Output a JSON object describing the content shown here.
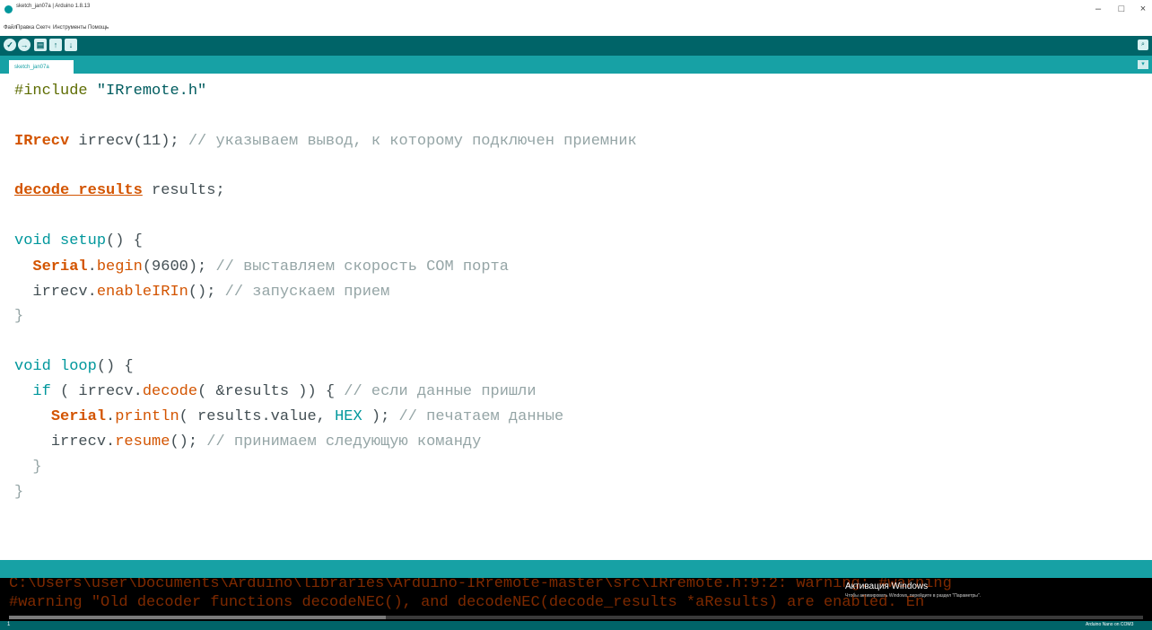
{
  "window": {
    "title": "sketch_jan07a | Arduino 1.8.13",
    "minimize": "–",
    "maximize": "□",
    "close": "×"
  },
  "menu": [
    "Файл",
    "Правка",
    "Скетч",
    "Инструменты",
    "Помощь"
  ],
  "toolbar": {
    "verify": "✓",
    "upload": "→",
    "new": "▤",
    "open": "↑",
    "save": "↓",
    "serial_monitor": "⌕"
  },
  "tab": {
    "name": "sketch_jan07a",
    "menu": "▾"
  },
  "code": {
    "l1": {
      "pre": "#include",
      "str": "\"IRremote.h\""
    },
    "l3": {
      "type": "IRrecv",
      "rest": " irrecv(11); ",
      "cmt": "// указываем вывод, к которому подключен приемник"
    },
    "l5": {
      "type": "decode_results",
      "rest": " results;"
    },
    "l7": {
      "kw": "void",
      "sp": " ",
      "fn": "setup",
      "rest": "() {"
    },
    "l8": {
      "ind": "  ",
      "obj": "Serial",
      "dot": ".",
      "fn": "begin",
      "rest": "(9600); ",
      "cmt": "// выставляем скорость COM порта"
    },
    "l9": {
      "ind": "  ",
      "pre": "irrecv.",
      "fn": "enableIRIn",
      "rest": "(); ",
      "cmt": "// запускаем прием"
    },
    "l10": {
      "text": "}"
    },
    "l12": {
      "kw": "void",
      "sp": " ",
      "fn": "loop",
      "rest": "() {"
    },
    "l13": {
      "ind": "  ",
      "kw": "if",
      "a": " ( irrecv.",
      "fn": "decode",
      "b": "( &results )) { ",
      "cmt": "// если данные пришли"
    },
    "l14": {
      "ind": "    ",
      "obj": "Serial",
      "dot": ".",
      "fn": "println",
      "a": "( results.value, ",
      "const": "HEX",
      "b": " ); ",
      "cmt": "// печатаем данные"
    },
    "l15": {
      "ind": "    ",
      "pre": "irrecv.",
      "fn": "resume",
      "rest": "(); ",
      "cmt": "// принимаем следующую команду"
    },
    "l16": {
      "text": "  }"
    },
    "l17": {
      "text": "}"
    }
  },
  "console": {
    "line1": "C:\\Users\\user\\Documents\\Arduino\\libraries\\Arduino-IRremote-master\\src\\IRremote.h:9:2: warning: #warning",
    "line2": "#warning \"Old decoder functions decodeNEC(), and decodeNEC(decode_results *aResults) are enabled. En",
    "activation_title": "Активация Windows",
    "activation_sub": "Чтобы активировать Windows, перейдите в раздел \"Параметры\"."
  },
  "status": {
    "line": "1",
    "board": "Arduino Nano on COM3"
  },
  "colors": {
    "toolbar": "#006468",
    "tabbar": "#17a1a5",
    "keyword_orange": "#d35400",
    "keyword_teal": "#00979c",
    "comment": "#95a5a6",
    "console_bg": "#000000",
    "console_text": "#e34c00"
  }
}
